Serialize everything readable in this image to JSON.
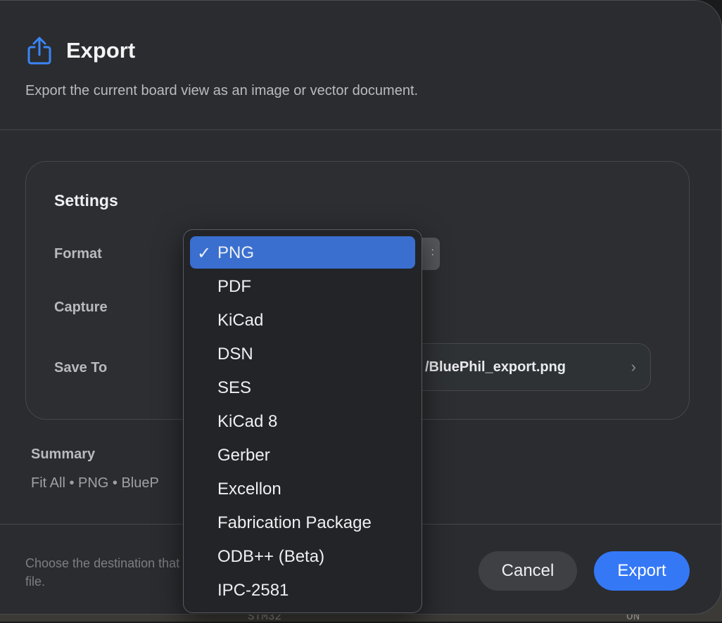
{
  "dialog": {
    "title": "Export",
    "subtitle": "Export the current board view as an image or vector document."
  },
  "settings": {
    "title": "Settings",
    "format_label": "Format",
    "capture_label": "Capture",
    "save_to_label": "Save To",
    "save_path": "/BluePhil_export.png"
  },
  "summary": {
    "title": "Summary",
    "text": "Fit All • PNG • BlueP"
  },
  "footer": {
    "hint": "Choose the destination that file.",
    "cancel_label": "Cancel",
    "export_label": "Export"
  },
  "format_menu": {
    "selected_check": "✓",
    "items": [
      "PNG",
      "PDF",
      "KiCad",
      "DSN",
      "SES",
      "KiCad 8",
      "Gerber",
      "Excellon",
      "Fabrication Package",
      "ODB++ (Beta)",
      "IPC-2581"
    ]
  },
  "background": {
    "text_1": "STM32",
    "text_2": "ON"
  },
  "icons": {
    "export": "share-icon",
    "chevron": "chevron-right-icon"
  },
  "colors": {
    "accent": "#3478f6",
    "selected_item": "#3a6fd0"
  }
}
